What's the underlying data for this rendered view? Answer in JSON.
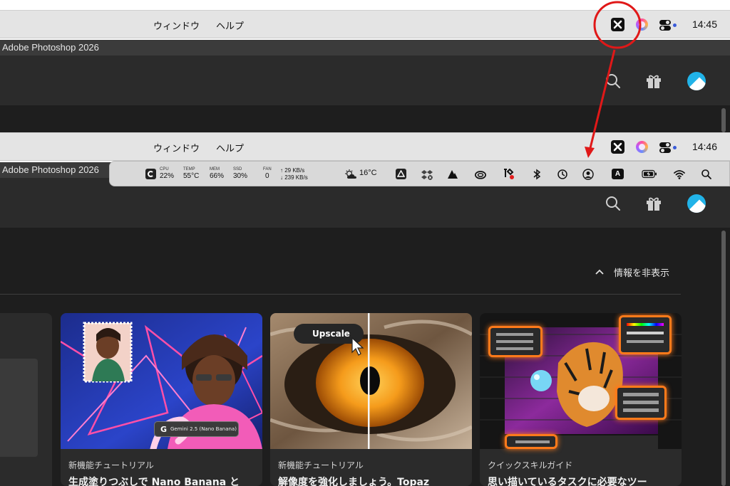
{
  "menubar_top": {
    "menu_items": [
      "ウィンドウ",
      "ヘルプ"
    ],
    "time": "14:45"
  },
  "menubar_bottom": {
    "menu_items": [
      "ウィンドウ",
      "ヘルプ"
    ],
    "time": "14:46"
  },
  "window": {
    "title": "Adobe Photoshop 2026"
  },
  "stats_bar": {
    "cpu_label": "CPU",
    "cpu_value": "22%",
    "temp_label": "TEMP",
    "temp_value": "55°C",
    "mem_label": "MEM",
    "mem_value": "66%",
    "ssd_label": "SSD",
    "ssd_value": "30%",
    "fan_label": "FAN",
    "fan_value": "0",
    "net_up": "↑ 29 KB/s",
    "net_down": "↓ 239 KB/s",
    "weather": "16°C",
    "icons": [
      "cleanmymac-icon",
      "weather-icon",
      "drive-icon",
      "dropbox-icon",
      "affinity-icon",
      "creative-cloud-icon",
      "tools-icon",
      "bluetooth-icon",
      "time-machine-icon",
      "user-icon",
      "keyboard-input-icon",
      "battery-icon",
      "wifi-icon",
      "spotlight-icon"
    ],
    "input_letter": "A"
  },
  "photoshop": {
    "toolbar_icons": [
      "search-icon",
      "gift-icon",
      "account-icon"
    ],
    "hide_info_label": "情報を非表示"
  },
  "cards": [
    {
      "category": "新機能チュートリアル",
      "title": "生成塗りつぶしで Nano Banana と",
      "badge": "Gemini 2.5 (Nano Banana)"
    },
    {
      "category": "新機能チュートリアル",
      "title": "解像度を強化しましょう。Topaz",
      "badge": "Upscale"
    },
    {
      "category": "クイックスキルガイド",
      "title": "思い描いているタスクに必要なツー",
      "badge": ""
    }
  ],
  "annotation": {
    "color": "#e01818"
  }
}
